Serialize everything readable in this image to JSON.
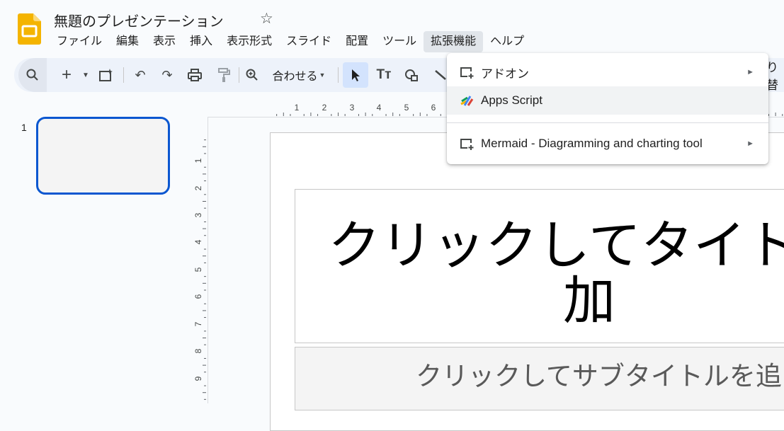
{
  "app": {
    "title": "無題のプレゼンテーション",
    "star": "☆"
  },
  "menu": [
    "ファイル",
    "編集",
    "表示",
    "挿入",
    "表示形式",
    "スライド",
    "配置",
    "ツール",
    "拡張機能",
    "ヘルプ"
  ],
  "active_menu": "拡張機能",
  "toolbar": {
    "zoom_label": "合わせる",
    "replace_label": "り替"
  },
  "filmstrip": {
    "slide_number": "1"
  },
  "ruler": {
    "horizontal": [
      "1",
      "2",
      "3",
      "4",
      "5",
      "6"
    ],
    "vertical": [
      "1",
      "2",
      "3",
      "4",
      "5",
      "6",
      "7",
      "8",
      "9"
    ]
  },
  "slide": {
    "title_placeholder": "クリックしてタイトル\n加",
    "subtitle_placeholder": "クリックしてサブタイトルを追"
  },
  "extensions_menu": {
    "items": [
      {
        "label": "アドオン",
        "icon": "add-on-icon",
        "submenu": true
      },
      {
        "label": "Apps Script",
        "icon": "apps-script-icon",
        "submenu": false,
        "highlighted": true
      },
      {
        "label": "Mermaid - Diagramming and charting tool",
        "icon": "add-on-icon",
        "submenu": true
      }
    ],
    "arrow": "►"
  },
  "colors": {
    "accent": "#0b57d0",
    "toolbar_bg": "#edf2fa",
    "logo": "#f4b400"
  }
}
